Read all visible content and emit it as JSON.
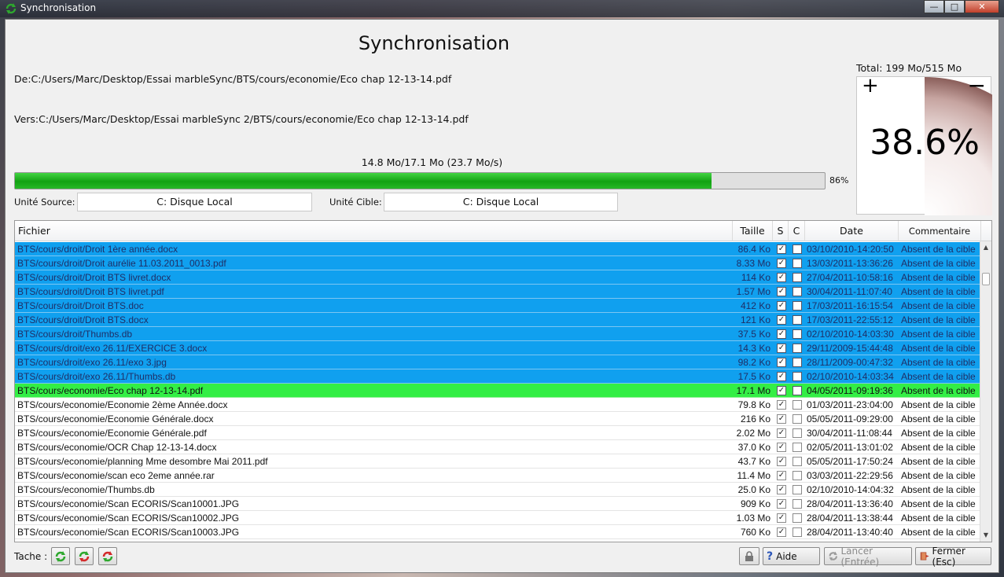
{
  "window": {
    "title": "Synchronisation"
  },
  "header": {
    "title": "Synchronisation",
    "source_path": "De:C:/Users/Marc/Desktop/Essai marbleSync/BTS/cours/economie/Eco chap 12-13-14.pdf",
    "dest_path": "Vers:C:/Users/Marc/Desktop/Essai marbleSync 2/BTS/cours/economie/Eco chap 12-13-14.pdf",
    "speed": "14.8 Mo/17.1 Mo (23.7 Mo/s)",
    "progress_percent": 86,
    "progress_label": "86%"
  },
  "units": {
    "source_label": "Unité Source:",
    "source_value": "C: Disque Local",
    "target_label": "Unité Cible:",
    "target_value": "C: Disque Local"
  },
  "total": {
    "label": "Total: 199 Mo/515 Mo",
    "percent": 38.6,
    "percent_label": "38.6%",
    "plus": "+",
    "minus": "−"
  },
  "table": {
    "columns": [
      "Fichier",
      "Taille",
      "S",
      "C",
      "Date",
      "Commentaire"
    ],
    "rows": [
      {
        "file": "BTS/cours/droit/Droit 1ère année.docx",
        "size": "86.4 Ko",
        "s": true,
        "c": false,
        "date": "03/10/2010-14:20:50",
        "comment": "Absent de la cible",
        "state": "sel"
      },
      {
        "file": "BTS/cours/droit/Droit aurélie 11.03.2011_0013.pdf",
        "size": "8.33 Mo",
        "s": true,
        "c": false,
        "date": "13/03/2011-13:36:26",
        "comment": "Absent de la cible",
        "state": "sel"
      },
      {
        "file": "BTS/cours/droit/Droit BTS livret.docx",
        "size": "114 Ko",
        "s": true,
        "c": false,
        "date": "27/04/2011-10:58:16",
        "comment": "Absent de la cible",
        "state": "sel"
      },
      {
        "file": "BTS/cours/droit/Droit BTS livret.pdf",
        "size": "1.57 Mo",
        "s": true,
        "c": false,
        "date": "30/04/2011-11:07:40",
        "comment": "Absent de la cible",
        "state": "sel"
      },
      {
        "file": "BTS/cours/droit/Droit BTS.doc",
        "size": "412 Ko",
        "s": true,
        "c": false,
        "date": "17/03/2011-16:15:54",
        "comment": "Absent de la cible",
        "state": "sel"
      },
      {
        "file": "BTS/cours/droit/Droit BTS.docx",
        "size": "121 Ko",
        "s": true,
        "c": false,
        "date": "17/03/2011-22:55:12",
        "comment": "Absent de la cible",
        "state": "sel"
      },
      {
        "file": "BTS/cours/droit/Thumbs.db",
        "size": "37.5 Ko",
        "s": true,
        "c": false,
        "date": "02/10/2010-14:03:30",
        "comment": "Absent de la cible",
        "state": "sel"
      },
      {
        "file": "BTS/cours/droit/exo 26.11/EXERCICE 3.docx",
        "size": "14.3 Ko",
        "s": true,
        "c": false,
        "date": "29/11/2009-15:44:48",
        "comment": "Absent de la cible",
        "state": "sel"
      },
      {
        "file": "BTS/cours/droit/exo 26.11/exo 3.jpg",
        "size": "98.2 Ko",
        "s": true,
        "c": false,
        "date": "28/11/2009-00:47:32",
        "comment": "Absent de la cible",
        "state": "sel"
      },
      {
        "file": "BTS/cours/droit/exo 26.11/Thumbs.db",
        "size": "17.5 Ko",
        "s": true,
        "c": false,
        "date": "02/10/2010-14:03:34",
        "comment": "Absent de la cible",
        "state": "sel"
      },
      {
        "file": "BTS/cours/economie/Eco chap 12-13-14.pdf",
        "size": "17.1 Mo",
        "s": true,
        "c": false,
        "date": "04/05/2011-09:19:36",
        "comment": "Absent de la cible",
        "state": "cur"
      },
      {
        "file": "BTS/cours/economie/Economie 2ème Année.docx",
        "size": "79.8 Ko",
        "s": true,
        "c": false,
        "date": "01/03/2011-23:04:00",
        "comment": "Absent de la cible",
        "state": ""
      },
      {
        "file": "BTS/cours/economie/Economie Générale.docx",
        "size": "216 Ko",
        "s": true,
        "c": false,
        "date": "05/05/2011-09:29:00",
        "comment": "Absent de la cible",
        "state": ""
      },
      {
        "file": "BTS/cours/economie/Economie Générale.pdf",
        "size": "2.02 Mo",
        "s": true,
        "c": false,
        "date": "30/04/2011-11:08:44",
        "comment": "Absent de la cible",
        "state": ""
      },
      {
        "file": "BTS/cours/economie/OCR Chap 12-13-14.docx",
        "size": "37.0 Ko",
        "s": true,
        "c": false,
        "date": "02/05/2011-13:01:02",
        "comment": "Absent de la cible",
        "state": ""
      },
      {
        "file": "BTS/cours/economie/planning Mme desombre Mai 2011.pdf",
        "size": "43.7 Ko",
        "s": true,
        "c": false,
        "date": "05/05/2011-17:50:24",
        "comment": "Absent de la cible",
        "state": ""
      },
      {
        "file": "BTS/cours/economie/scan eco 2eme année.rar",
        "size": "11.4 Mo",
        "s": true,
        "c": false,
        "date": "03/03/2011-22:29:56",
        "comment": "Absent de la cible",
        "state": ""
      },
      {
        "file": "BTS/cours/economie/Thumbs.db",
        "size": "25.0 Ko",
        "s": true,
        "c": false,
        "date": "02/10/2010-14:04:32",
        "comment": "Absent de la cible",
        "state": ""
      },
      {
        "file": "BTS/cours/economie/Scan ECORIS/Scan10001.JPG",
        "size": "909 Ko",
        "s": true,
        "c": false,
        "date": "28/04/2011-13:36:40",
        "comment": "Absent de la cible",
        "state": ""
      },
      {
        "file": "BTS/cours/economie/Scan ECORIS/Scan10002.JPG",
        "size": "1.03 Mo",
        "s": true,
        "c": false,
        "date": "28/04/2011-13:38:44",
        "comment": "Absent de la cible",
        "state": ""
      },
      {
        "file": "BTS/cours/economie/Scan ECORIS/Scan10003.JPG",
        "size": "760 Ko",
        "s": true,
        "c": false,
        "date": "28/04/2011-13:40:40",
        "comment": "Absent de la cible",
        "state": ""
      }
    ]
  },
  "footer": {
    "task_label": "Tache :",
    "help_label": "Aide",
    "launch_label": "Lancer (Entrée)",
    "close_label": "Fermer (Esc)"
  },
  "colors": {
    "selected_row": "#10a0ef",
    "current_row": "#33ee45",
    "progress": "#12a212"
  }
}
